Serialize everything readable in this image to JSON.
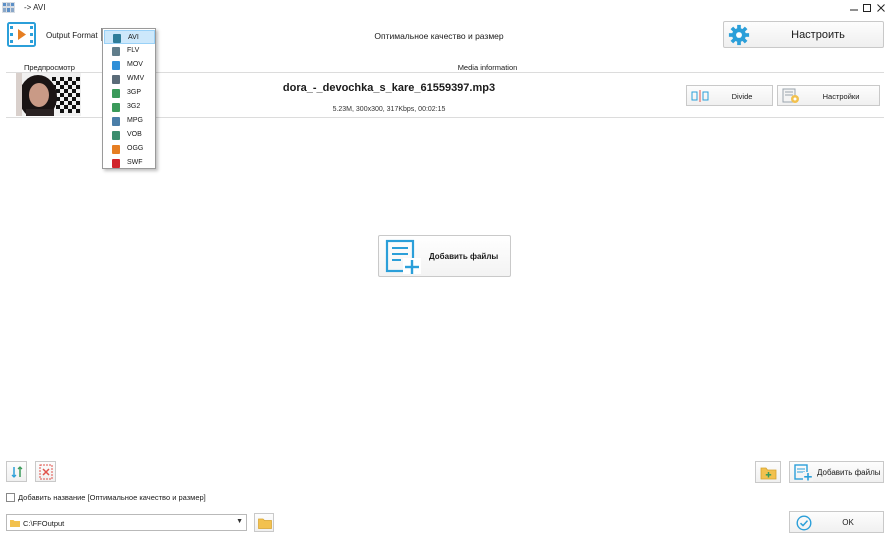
{
  "window": {
    "title": "-> AVI",
    "controls": [
      "minimize",
      "maximize",
      "close"
    ]
  },
  "toolbar": {
    "output_format_label": "Output Format",
    "selected_format": "AVI",
    "preset_title": "Оптимальное качество и размер",
    "configure_label": "Настроить",
    "configure_icon": "gear-icon"
  },
  "format_dropdown": {
    "items": [
      {
        "label": "AVI",
        "selected": true,
        "color": "#2e7d9a"
      },
      {
        "label": "FLV",
        "selected": false,
        "color": "#607d8b"
      },
      {
        "label": "MOV",
        "selected": false,
        "color": "#2f8fd8"
      },
      {
        "label": "WMV",
        "selected": false,
        "color": "#5a6b78"
      },
      {
        "label": "3GP",
        "selected": false,
        "color": "#3a9a5a"
      },
      {
        "label": "3G2",
        "selected": false,
        "color": "#3a9a5a"
      },
      {
        "label": "MPG",
        "selected": false,
        "color": "#4a7ea8"
      },
      {
        "label": "VOB",
        "selected": false,
        "color": "#3b8d6e"
      },
      {
        "label": "OGG",
        "selected": false,
        "color": "#e67e22"
      },
      {
        "label": "SWF",
        "selected": false,
        "color": "#d0232a"
      }
    ]
  },
  "file_list": {
    "columns": {
      "preview": "Предпросмотр",
      "media": "Media information"
    },
    "files": [
      {
        "name": "dora_-_devochka_s_kare_61559397.mp3",
        "info": "5.23M, 300x300, 317Kbps, 00:02:15",
        "divide_label": "Divide",
        "settings_label": "Настройки"
      }
    ]
  },
  "center": {
    "add_files_label": "Добавить файлы"
  },
  "bottom": {
    "add_files_label": "Добавить файлы",
    "add_title_label": "Добавить название [Оптимальное качество и размер]",
    "add_title_checked": false,
    "output_path": "C:\\FFOutput",
    "ok_label": "OK"
  },
  "colors": {
    "accent": "#2b9fd9",
    "danger": "#e0524a",
    "folder": "#f2c14e"
  }
}
